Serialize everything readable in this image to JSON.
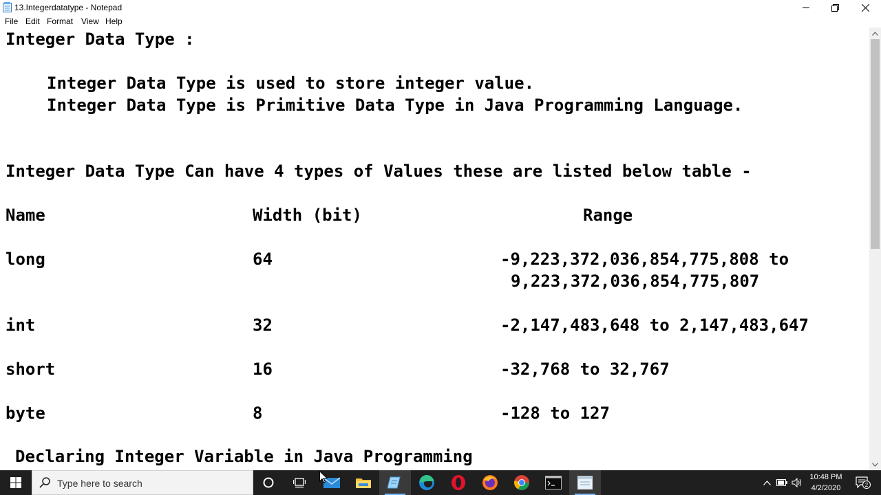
{
  "window": {
    "title": "13.Integerdatatype - Notepad"
  },
  "menu": [
    "File",
    "Edit",
    "Format",
    "View",
    "Help"
  ],
  "editor": {
    "lines": [
      "Integer Data Type :",
      "Integer Data Type is used to store integer value.",
      "Integer Data Type is Primitive Data Type in Java Programming Language.",
      "Integer Data Type Can have 4 types of Values these are listed below table -",
      "Declaring Integer Variable in Java Programming"
    ],
    "table": {
      "headers": [
        "Name",
        "Width (bit)",
        "Range"
      ],
      "rows": [
        {
          "name": "long",
          "width": "64",
          "range": "-9,223,372,036,854,775,808 to",
          "range2": "9,223,372,036,854,775,807"
        },
        {
          "name": "int",
          "width": "32",
          "range": "-2,147,483,648 to 2,147,483,647"
        },
        {
          "name": "short",
          "width": "16",
          "range": "-32,768 to 32,767"
        },
        {
          "name": "byte",
          "width": "8",
          "range": "-128 to 127"
        }
      ]
    }
  },
  "taskbar": {
    "search_placeholder": "Type here to search",
    "time": "10:48 PM",
    "date": "4/2/2020",
    "notification_count": "2"
  },
  "colors": {
    "taskbar": "#1f1f1f",
    "accent": "#79b8ff",
    "text": "#000000"
  }
}
